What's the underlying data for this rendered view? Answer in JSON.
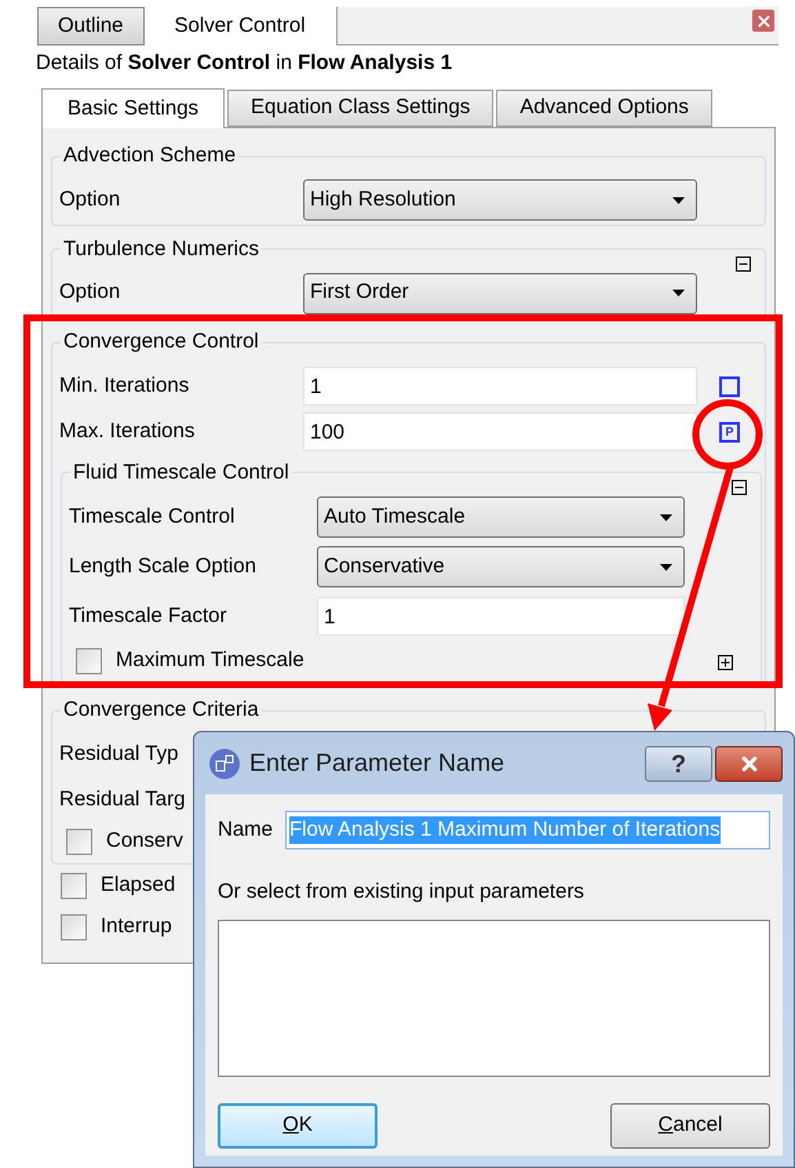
{
  "panel_tabs": [
    {
      "label": "Outline",
      "selected": false
    },
    {
      "label": "Solver Control",
      "selected": true
    }
  ],
  "details_title": "Details of **Solver Control** in **Flow Analysis 1**",
  "settings_tabs": [
    {
      "label": "Basic Settings",
      "selected": true
    },
    {
      "label": "Equation Class Settings",
      "selected": false
    },
    {
      "label": "Advanced Options",
      "selected": false
    }
  ],
  "parameter_mark": "P",
  "groups": [
    {
      "title": "Advection Scheme",
      "rows": [
        {
          "kind": "dropdown",
          "label": "Option",
          "value": "High Resolution"
        }
      ]
    },
    {
      "title": "Turbulence Numerics",
      "expanded": true,
      "rows": [
        {
          "kind": "dropdown",
          "label": "Option",
          "value": "First Order"
        }
      ]
    },
    {
      "title": "Convergence Control",
      "rows": [
        {
          "kind": "field",
          "label": "Min. Iterations",
          "value": "1",
          "parameterized": false
        },
        {
          "kind": "field",
          "label": "Max. Iterations",
          "value": "100",
          "parameterized": true
        }
      ],
      "subgroups": [
        {
          "title": "Fluid Timescale Control",
          "expanded": true,
          "rows": [
            {
              "kind": "dropdown",
              "label": "Timescale Control",
              "value": "Auto Timescale"
            },
            {
              "kind": "dropdown",
              "label": "Length Scale Option",
              "value": "Conservative"
            },
            {
              "kind": "field",
              "label": "Timescale Factor",
              "value": "1"
            }
          ],
          "options": [
            {
              "label": "Maximum Timescale",
              "checked": false,
              "expanded": false
            }
          ]
        }
      ]
    },
    {
      "title": "Convergence Criteria",
      "rows": [
        {
          "kind": "text",
          "label": "Residual Typ"
        },
        {
          "kind": "text",
          "label": "Residual Targ"
        }
      ],
      "options": [
        {
          "label": "Conserv",
          "checked": false
        }
      ]
    }
  ],
  "options": [
    {
      "label": "Elapsed",
      "checked": false
    },
    {
      "label": "Interrup",
      "checked": false
    }
  ],
  "dialog": {
    "title": "Enter Parameter Name",
    "help": "?",
    "name_label": "Name",
    "name_value": "Flow Analysis 1 Maximum Number of Iterations",
    "list_label": "Or select from existing input parameters",
    "buttons": [
      {
        "label": "OK",
        "default": true
      },
      {
        "label": "Cancel",
        "default": false
      }
    ]
  }
}
